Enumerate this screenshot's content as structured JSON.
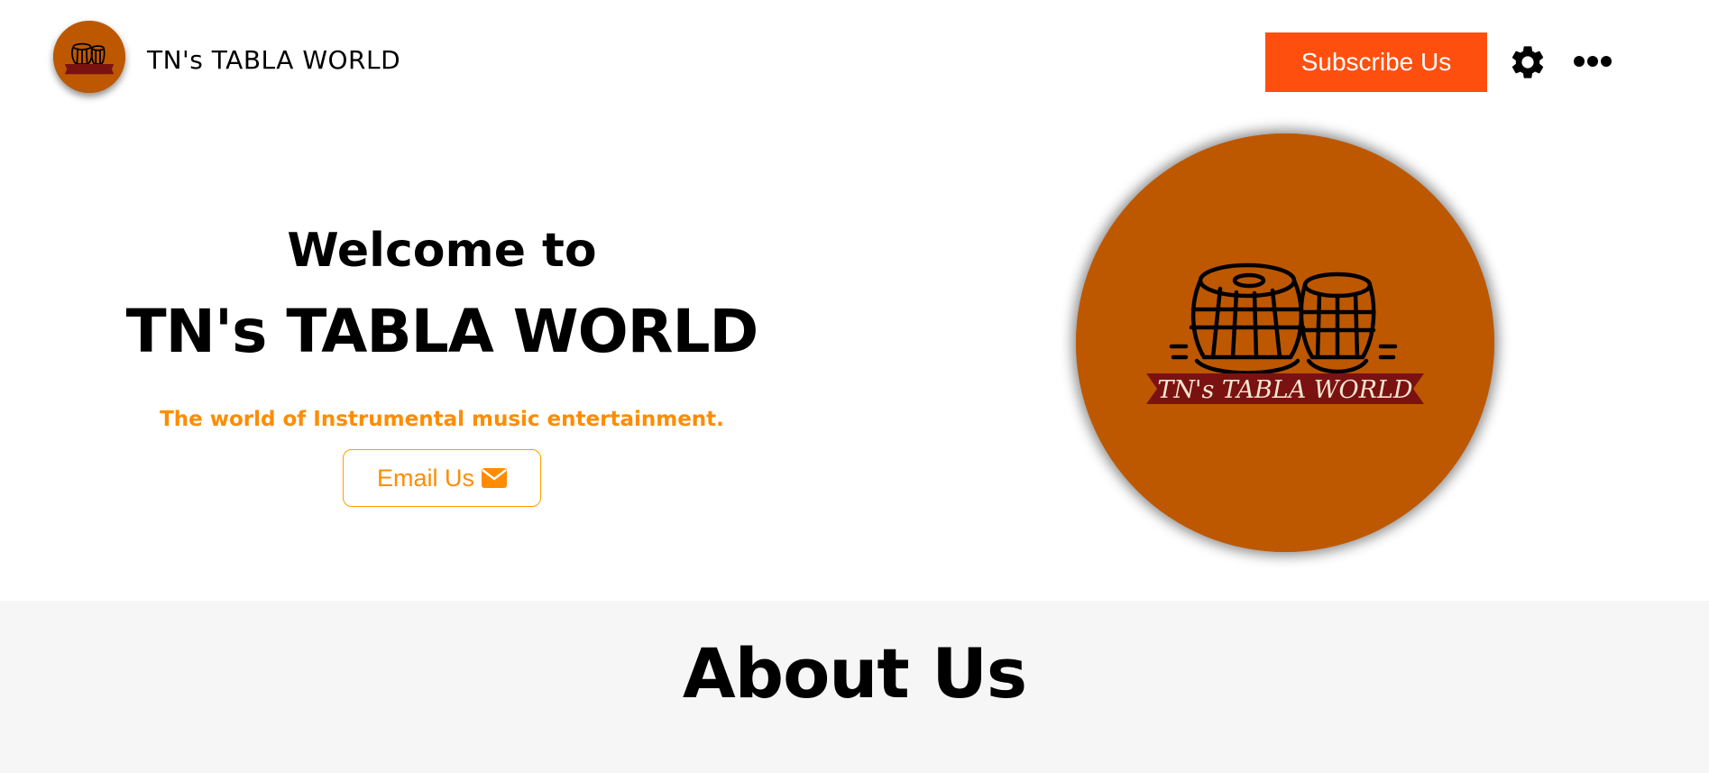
{
  "header": {
    "brand_name": "TN's TABLA WORLD",
    "subscribe_label": "Subscribe Us",
    "settings_icon": "gear-icon",
    "more_icon": "more-horizontal-icon"
  },
  "hero": {
    "welcome": "Welcome to",
    "title": "TN's TABLA WORLD",
    "tagline": "The world of Instrumental music entertainment.",
    "email_label": "Email Us",
    "email_icon": "envelope-icon",
    "logo_text": "TN's TABLA WORLD"
  },
  "about": {
    "title": "About Us"
  },
  "colors": {
    "brand_orange": "#bd5800",
    "subscribe_bg": "#ff4f0f",
    "accent_orange": "#ff8c00",
    "about_bg": "#f6f6f6",
    "banner_red": "#7a1212"
  }
}
